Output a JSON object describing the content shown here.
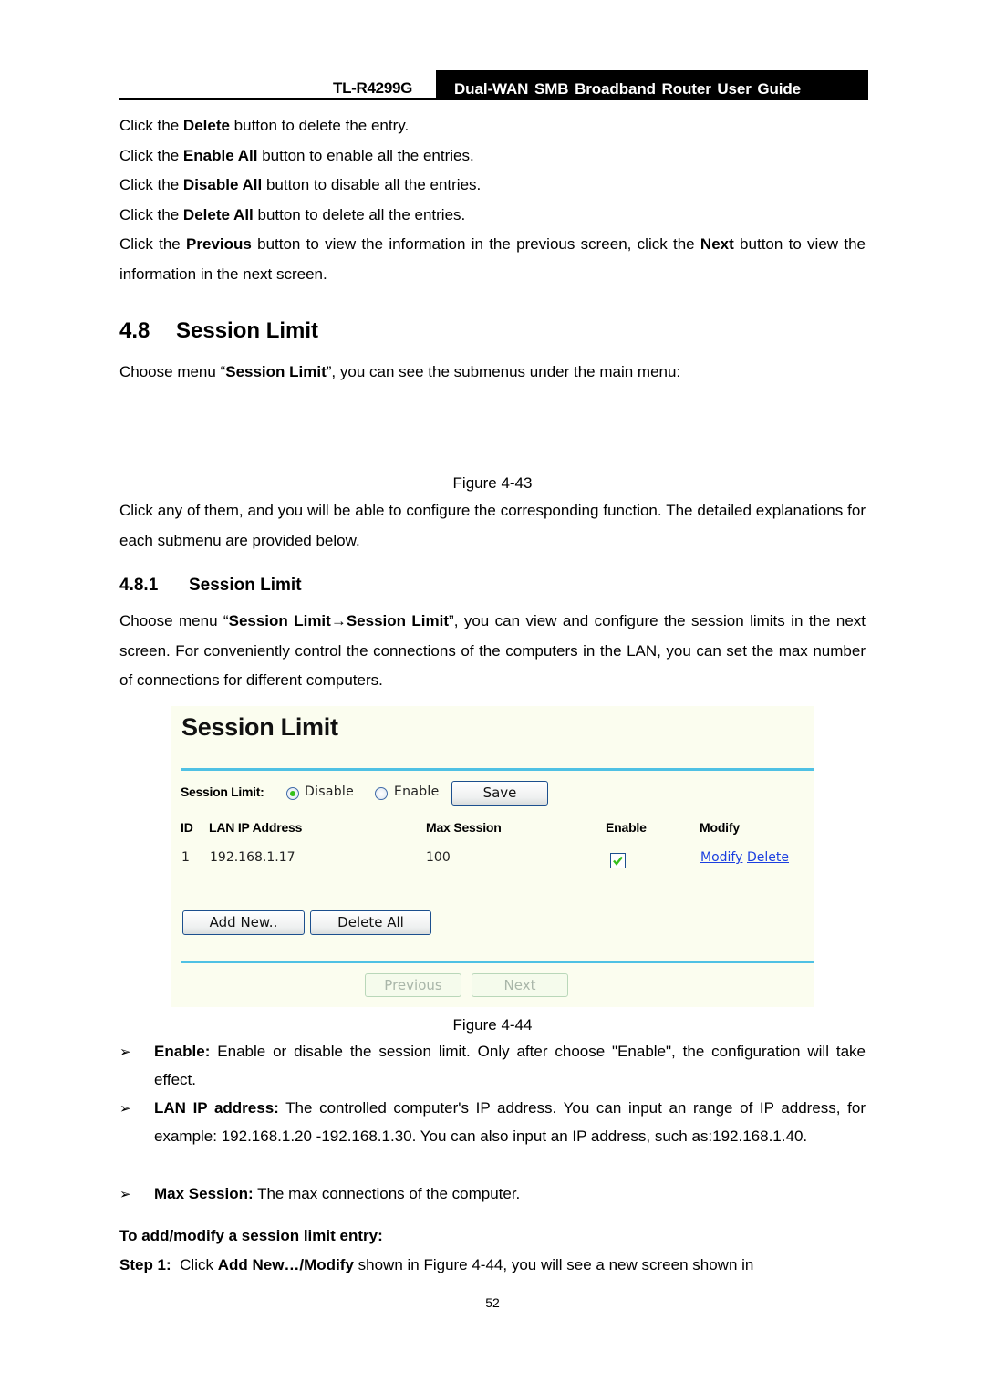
{
  "header": {
    "model": "TL-R4299G",
    "guide_title": "Dual-WAN SMB Broadband Router User Guide"
  },
  "intro_lines": [
    {
      "pre": "Click the ",
      "bold": "Delete",
      "post": " button to delete the entry."
    },
    {
      "pre": "Click the ",
      "bold": "Enable All",
      "post": " button to enable all the entries."
    },
    {
      "pre": "Click the ",
      "bold": "Disable All",
      "post": " button to disable all the entries."
    },
    {
      "pre": "Click the ",
      "bold": "Delete All",
      "post": " button to delete all the entries."
    }
  ],
  "prev_next_para": {
    "a": "Click the ",
    "b": "Previous",
    "c": " button to view the information in the previous screen, click the ",
    "d": "Next",
    "e": " button to view the information in the next screen."
  },
  "section": {
    "number": "4.8",
    "title": "Session Limit",
    "intro_pre": "Choose menu “",
    "intro_bold": "Session Limit",
    "intro_post": "”, you can see the submenus under the main menu:",
    "figure_43": "Figure 4-43",
    "after_fig": "Click any of them, and you will be able to configure the corresponding function. The detailed explanations for each submenu are provided below."
  },
  "subsection": {
    "number": "4.8.1",
    "title": "Session Limit",
    "para_pre": "Choose menu “",
    "para_bold": "Session Limit→Session Limit",
    "para_post": "”, you can view and configure the session limits in the next screen. For conveniently control the connections of the computers in the LAN, you can set the max number of connections for different computers."
  },
  "router_ui": {
    "title": "Session Limit",
    "session_limit_label": "Session Limit:",
    "radio_disable": "Disable",
    "radio_enable": "Enable",
    "selected": "Disable",
    "save_label": "Save",
    "columns": [
      "ID",
      "LAN IP Address",
      "Max Session",
      "Enable",
      "Modify"
    ],
    "rows": [
      {
        "id": "1",
        "ip": "192.168.1.17",
        "max_session": "100",
        "enabled": true,
        "modify": "Modify",
        "delete": "Delete"
      }
    ],
    "add_new_label": "Add New..",
    "delete_all_label": "Delete All",
    "previous_label": "Previous",
    "next_label": "Next",
    "colors": {
      "accent_rule": "#4fc1e4",
      "background": "#fbfdef",
      "link": "#1b3fe0",
      "check": "#35c01b"
    }
  },
  "figure_44": "Figure 4-44",
  "bullets": [
    {
      "term": "Enable:",
      "text": " Enable or disable the session limit. Only after choose \"Enable\", the configuration will take effect."
    },
    {
      "term": "LAN IP address:",
      "text": " The controlled computer's IP address. You can input an range of IP address, for example: 192.168.1.20 -192.168.1.30. You can also input an IP address, such as:192.168.1.40."
    },
    {
      "term": "Max Session:",
      "text": " The max connections of the computer."
    }
  ],
  "procedure": {
    "heading": "To add/modify a session limit entry:",
    "step_label": "Step 1:",
    "step_pre": "  Click ",
    "step_bold": "Add New…/Modify",
    "step_post": " shown in Figure 4-44, you will see a new screen shown in"
  },
  "page_number": "52",
  "bullet_glyph": "➢"
}
